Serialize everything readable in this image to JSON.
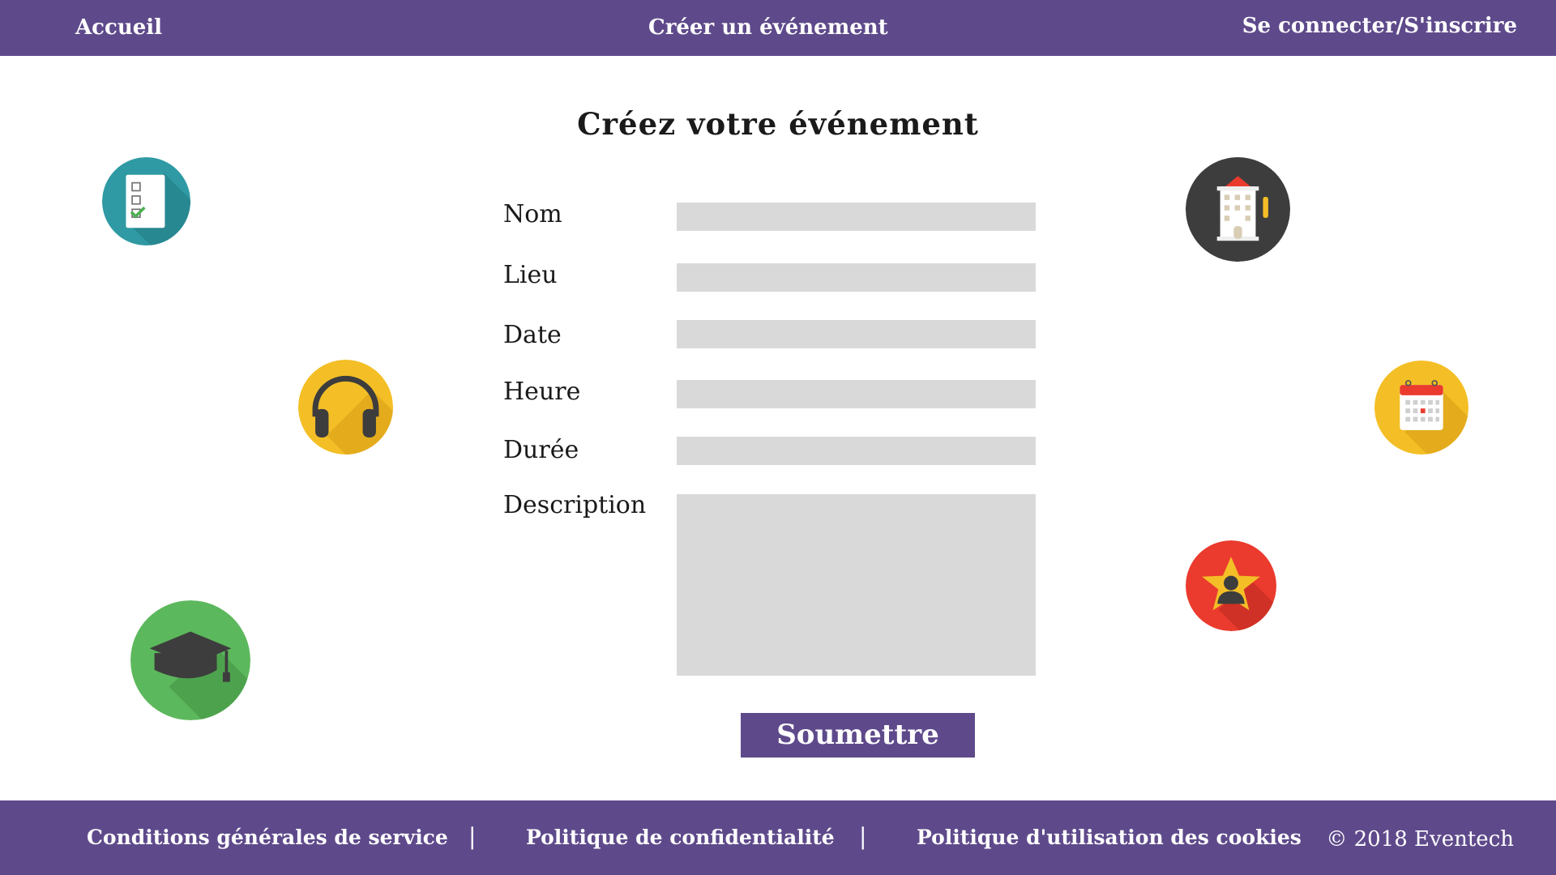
{
  "nav": {
    "home": "Accueil",
    "create_event": "Créer un événement",
    "login": "Se connecter/S'inscrire"
  },
  "page": {
    "title": "Créez votre événement"
  },
  "form": {
    "name_label": "Nom",
    "name_value": "",
    "place_label": "Lieu",
    "place_value": "",
    "date_label": "Date",
    "date_value": "",
    "time_label": "Heure",
    "time_value": "",
    "duration_label": "Durée",
    "duration_value": "",
    "description_label": "Description",
    "description_value": "",
    "submit_label": "Soumettre"
  },
  "footer": {
    "terms": "Conditions générales de service",
    "separator": "|",
    "privacy": "Politique de confidentialité",
    "cookies": "Politique d'utilisation des cookies",
    "copyright": "© 2018 Eventech"
  },
  "icons": {
    "checklist": "checklist-icon",
    "headphones": "headphones-icon",
    "graduation": "graduation-cap-icon",
    "building": "building-icon",
    "calendar": "calendar-icon",
    "star_person": "star-person-icon"
  },
  "colors": {
    "brand": "#5e4a8b",
    "field": "#d9d9d9",
    "teal": "#2f9aa3",
    "yellow": "#f4bf26",
    "green": "#5cb85c",
    "dark": "#3d3d3d",
    "red": "#ea3b2e"
  }
}
